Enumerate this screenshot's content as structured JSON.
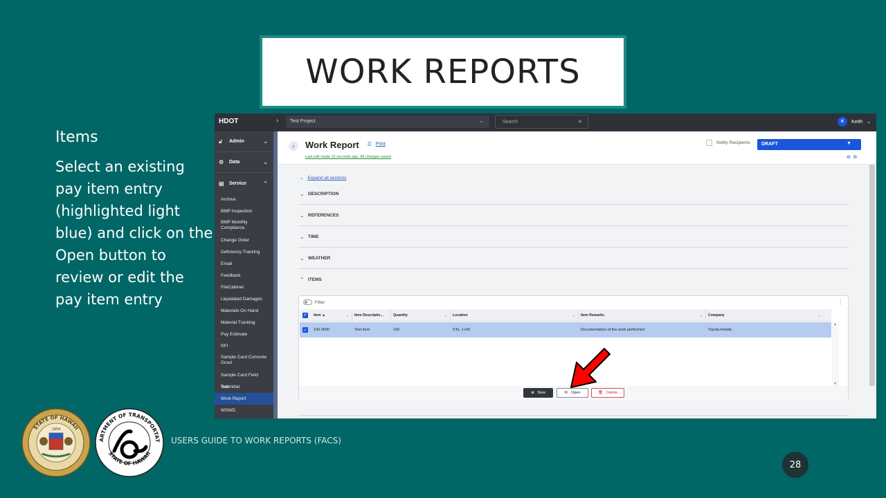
{
  "slide": {
    "title": "WORK REPORTS",
    "left_heading": "Items",
    "left_body": "Select an existing pay item entry (highlighted light blue) and click on the Open button to review or edit the pay item entry",
    "footer": "USERS GUIDE TO WORK REPORTS  (FACS)",
    "page_number": "28",
    "seal_top_text": "STATE OF HAWAII",
    "seal_year": "1959",
    "dot_top_text": "DEPARTMENT OF TRANSPORTATION",
    "dot_bottom_text": "STATE OF HAWAII"
  },
  "topbar": {
    "brand": "HDOT",
    "project": "Test Project",
    "search_placeholder": "Search",
    "user_initial": "K",
    "user_name": "Keith"
  },
  "sidebar": {
    "groups": [
      {
        "label": "Admin"
      },
      {
        "label": "Data"
      },
      {
        "label": "Service"
      }
    ],
    "items": [
      {
        "label": "Archive"
      },
      {
        "label": "BMP Inspection"
      },
      {
        "label": "BMP Monthly Compliance"
      },
      {
        "label": "Change Order"
      },
      {
        "label": "Deficiency Tracking"
      },
      {
        "label": "Email"
      },
      {
        "label": "Feedback"
      },
      {
        "label": "FileCabinet"
      },
      {
        "label": "Liquidated Damages"
      },
      {
        "label": "Materials On Hand"
      },
      {
        "label": "Material Tracking"
      },
      {
        "label": "Pay Estimate"
      },
      {
        "label": "RFI"
      },
      {
        "label": "Sample Card Concrete Grout"
      },
      {
        "label": "Sample Card Field Test"
      },
      {
        "label": "Submittal"
      },
      {
        "label": "Work Report"
      },
      {
        "label": "WSWD"
      }
    ],
    "active_item": "Work Report"
  },
  "header": {
    "title": "Work Report",
    "print_label": "Print",
    "last_edit": "Last edit made 15 seconds ago. All changes saved",
    "notify_label": "Notify Recipients",
    "status": "DRAFT"
  },
  "sections": {
    "expand_all": "Expand all sections",
    "list": [
      {
        "label": "DESCRIPTION",
        "expanded": false
      },
      {
        "label": "REFERENCES",
        "expanded": false
      },
      {
        "label": "TIME",
        "expanded": false
      },
      {
        "label": "WEATHER",
        "expanded": false
      },
      {
        "label": "ITEMS",
        "expanded": true
      }
    ]
  },
  "items_grid": {
    "filter_label": "Filter",
    "columns": [
      "Item",
      "Item Descriptio...",
      "Quantity",
      "Location",
      "Item Remarks",
      "Company"
    ],
    "sort_indicator": "▲",
    "rows": [
      {
        "item": "100.0000",
        "description": "Test Item",
        "quantity": "100",
        "location": "STa. 1+00",
        "remarks": "Documentation of the work performed",
        "company": "Toyota Honda",
        "selected": true
      }
    ],
    "buttons": {
      "new": "New",
      "open": "Open",
      "delete": "Delete"
    }
  },
  "colors": {
    "background": "#006666",
    "accent_blue": "#1a56db",
    "selected_row": "#b5cbf0",
    "arrow_red": "#ff0000"
  }
}
